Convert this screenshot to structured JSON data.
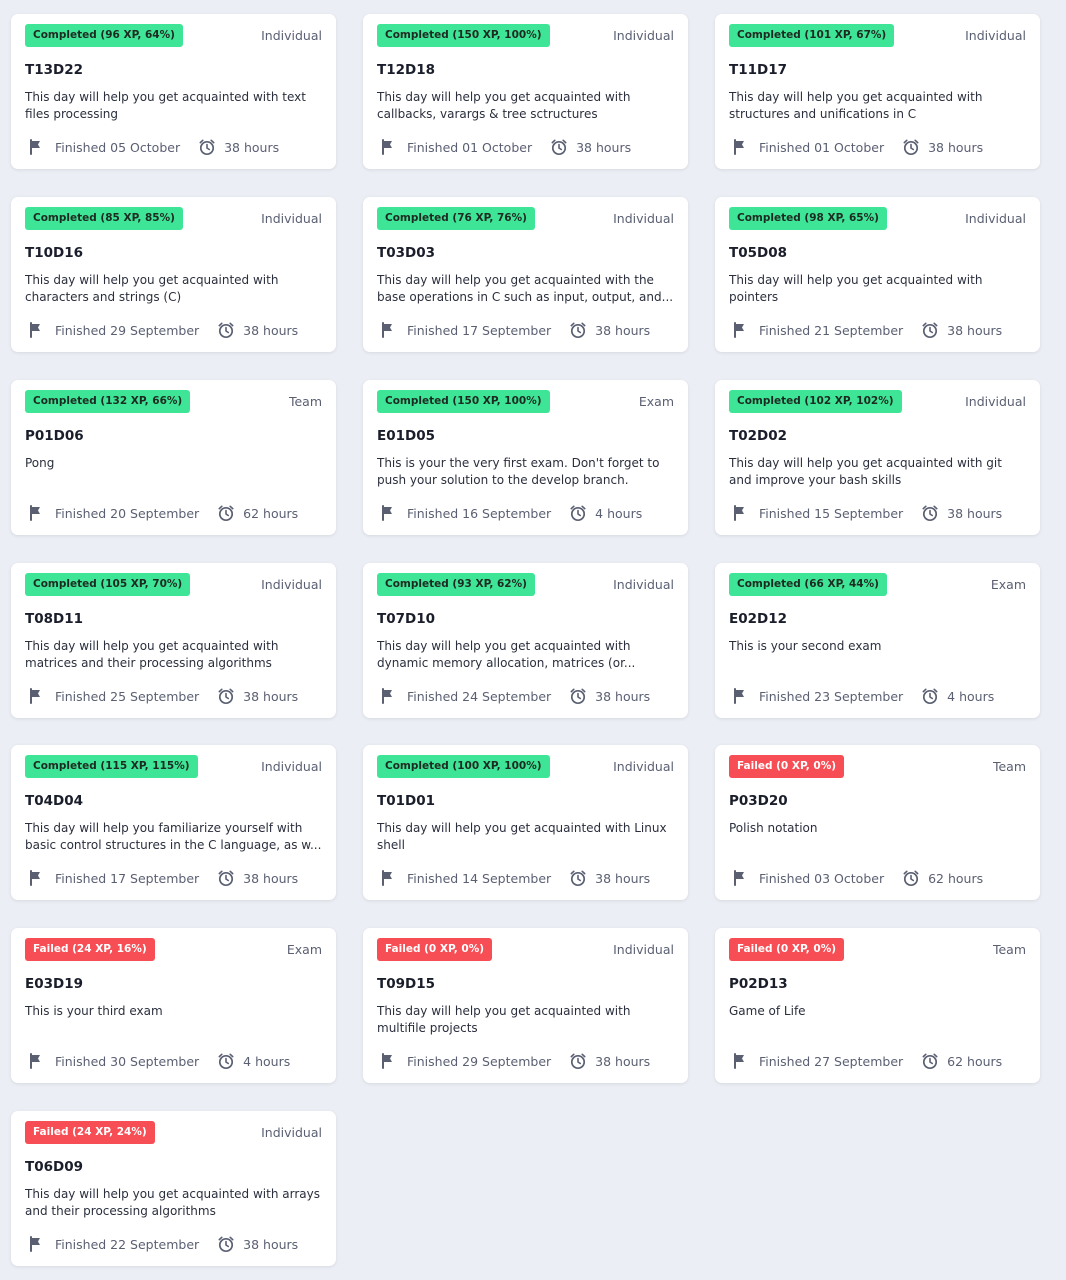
{
  "cards": [
    {
      "status": "completed",
      "status_label": "Completed (96 XP, 64%)",
      "type": "Individual",
      "code": "T13D22",
      "description": "This day will help you get acquainted with text files processing",
      "finished": "Finished 05 October",
      "duration": "38 hours"
    },
    {
      "status": "completed",
      "status_label": "Completed (150 XP, 100%)",
      "type": "Individual",
      "code": "T12D18",
      "description": "This day will help you get acquainted with callbacks, varargs & tree sctructures",
      "finished": "Finished 01 October",
      "duration": "38 hours"
    },
    {
      "status": "completed",
      "status_label": "Completed (101 XP, 67%)",
      "type": "Individual",
      "code": "T11D17",
      "description": "This day will help you get acquainted with structures and unifications in C",
      "finished": "Finished 01 October",
      "duration": "38 hours"
    },
    {
      "status": "completed",
      "status_label": "Completed (85 XP, 85%)",
      "type": "Individual",
      "code": "T10D16",
      "description": "This day will help you get acquainted with characters and strings (C)",
      "finished": "Finished 29 September",
      "duration": "38 hours"
    },
    {
      "status": "completed",
      "status_label": "Completed (76 XP, 76%)",
      "type": "Individual",
      "code": "T03D03",
      "description": "This day will help you get acquainted with the base operations in C such as input, output, and...",
      "finished": "Finished 17 September",
      "duration": "38 hours"
    },
    {
      "status": "completed",
      "status_label": "Completed (98 XP, 65%)",
      "type": "Individual",
      "code": "T05D08",
      "description": "This day will help you get acquainted with pointers",
      "finished": "Finished 21 September",
      "duration": "38 hours"
    },
    {
      "status": "completed",
      "status_label": "Completed (132 XP, 66%)",
      "type": "Team",
      "code": "P01D06",
      "description": "Pong",
      "finished": "Finished 20 September",
      "duration": "62 hours"
    },
    {
      "status": "completed",
      "status_label": "Completed (150 XP, 100%)",
      "type": "Exam",
      "code": "E01D05",
      "description": "This is your the very first exam. Don't forget to push your solution to the develop branch.",
      "finished": "Finished 16 September",
      "duration": "4 hours"
    },
    {
      "status": "completed",
      "status_label": "Completed (102 XP, 102%)",
      "type": "Individual",
      "code": "T02D02",
      "description": "This day will help you get acquainted with git and improve your bash skills",
      "finished": "Finished 15 September",
      "duration": "38 hours"
    },
    {
      "status": "completed",
      "status_label": "Completed (105 XP, 70%)",
      "type": "Individual",
      "code": "T08D11",
      "description": "This day will help you get acquainted with matrices and their processing algorithms",
      "finished": "Finished 25 September",
      "duration": "38 hours"
    },
    {
      "status": "completed",
      "status_label": "Completed (93 XP, 62%)",
      "type": "Individual",
      "code": "T07D10",
      "description": "This day will help you get acquainted with dynamic memory allocation, matrices (or...",
      "finished": "Finished 24 September",
      "duration": "38 hours"
    },
    {
      "status": "completed",
      "status_label": "Completed (66 XP, 44%)",
      "type": "Exam",
      "code": "E02D12",
      "description": "This is your second exam",
      "finished": "Finished 23 September",
      "duration": "4 hours"
    },
    {
      "status": "completed",
      "status_label": "Completed (115 XP, 115%)",
      "type": "Individual",
      "code": "T04D04",
      "description": "This day will help you familiarize yourself with basic control structures in the C language, as w...",
      "finished": "Finished 17 September",
      "duration": "38 hours"
    },
    {
      "status": "completed",
      "status_label": "Completed (100 XP, 100%)",
      "type": "Individual",
      "code": "T01D01",
      "description": "This day will help you get acquainted with Linux shell",
      "finished": "Finished 14 September",
      "duration": "38 hours"
    },
    {
      "status": "failed",
      "status_label": "Failed (0 XP, 0%)",
      "type": "Team",
      "code": "P03D20",
      "description": "Polish notation",
      "finished": "Finished 03 October",
      "duration": "62 hours"
    },
    {
      "status": "failed",
      "status_label": "Failed (24 XP, 16%)",
      "type": "Exam",
      "code": "E03D19",
      "description": "This is your third exam",
      "finished": "Finished 30 September",
      "duration": "4 hours"
    },
    {
      "status": "failed",
      "status_label": "Failed (0 XP, 0%)",
      "type": "Individual",
      "code": "T09D15",
      "description": "This day will help you get acquainted with multifile projects",
      "finished": "Finished 29 September",
      "duration": "38 hours"
    },
    {
      "status": "failed",
      "status_label": "Failed (0 XP, 0%)",
      "type": "Team",
      "code": "P02D13",
      "description": "Game of Life",
      "finished": "Finished 27 September",
      "duration": "62 hours"
    },
    {
      "status": "failed",
      "status_label": "Failed (24 XP, 24%)",
      "type": "Individual",
      "code": "T06D09",
      "description": "This day will help you get acquainted with arrays and their processing algorithms",
      "finished": "Finished 22 September",
      "duration": "38 hours"
    }
  ],
  "icons": {
    "finished": "flag-icon",
    "duration": "alarm-clock-icon"
  },
  "colors": {
    "background": "#eceef5",
    "completed": "#3ee596",
    "failed": "#f74d55"
  }
}
